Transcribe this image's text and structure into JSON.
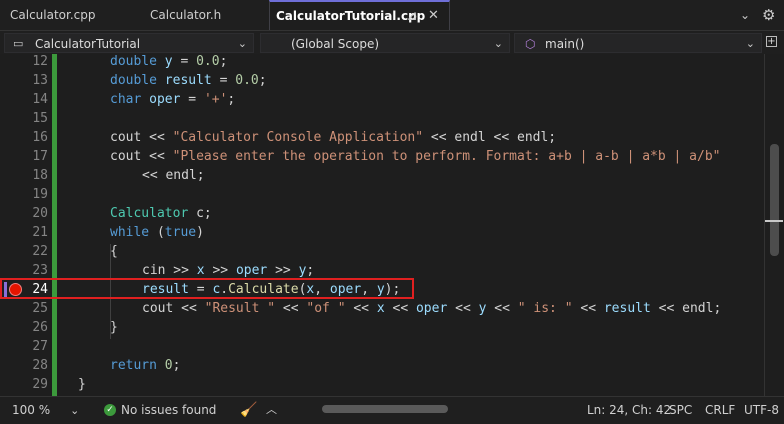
{
  "tabs": [
    {
      "label": "Calculator.cpp"
    },
    {
      "label": "Calculator.h"
    },
    {
      "label": "CalculatorTutorial.cpp"
    }
  ],
  "tab_icons": {
    "pin": "pin-icon",
    "close": "close-icon",
    "overflow": "chevron-down-icon",
    "settings": "gear-icon"
  },
  "nav": {
    "project": "CalculatorTutorial",
    "scope": "(Global Scope)",
    "member": "main()"
  },
  "editor": {
    "current_line": 24,
    "breakpoint_line": 24,
    "lines": [
      {
        "n": "12"
      },
      {
        "n": "13"
      },
      {
        "n": "14"
      },
      {
        "n": "15"
      },
      {
        "n": "16"
      },
      {
        "n": "17"
      },
      {
        "n": "18"
      },
      {
        "n": "19"
      },
      {
        "n": "20"
      },
      {
        "n": "21"
      },
      {
        "n": "22"
      },
      {
        "n": "23"
      },
      {
        "n": "24"
      },
      {
        "n": "25"
      },
      {
        "n": "26"
      },
      {
        "n": "27"
      },
      {
        "n": "28"
      },
      {
        "n": "29"
      }
    ],
    "code": {
      "l12_kw": "double",
      "l12_var": "y",
      "l12_op": " = ",
      "l12_num": "0.0",
      "l12_end": ";",
      "l13_kw": "double",
      "l13_var": "result",
      "l13_op": " = ",
      "l13_num": "0.0",
      "l13_end": ";",
      "l14_kw": "char",
      "l14_var": "oper",
      "l14_op": " = ",
      "l14_str": "'+'",
      "l14_end": ";",
      "l16_a": "cout << ",
      "l16_str": "\"Calculator Console Application\"",
      "l16_b": " << endl << endl;",
      "l17_a": "cout << ",
      "l17_str": "\"Please enter the operation to perform. Format: a+b | a-b | a*b | a/b\"",
      "l18_a": "<< endl;",
      "l20_ty": "Calculator",
      "l20_var": " c;",
      "l21_kw": "while",
      "l21_a": " (",
      "l21_kw2": "true",
      "l21_b": ")",
      "l22_a": "{",
      "l23_a": "cin >> ",
      "l23_v1": "x",
      "l23_b": " >> ",
      "l23_v2": "oper",
      "l23_c": " >> ",
      "l23_v3": "y",
      "l23_d": ";",
      "l24_v1": "result",
      "l24_a": " = ",
      "l24_v2": "c",
      "l24_b": ".",
      "l24_fn": "Calculate",
      "l24_c": "(",
      "l24_v3": "x",
      "l24_d": ", ",
      "l24_v4": "oper",
      "l24_e": ", ",
      "l24_v5": "y",
      "l24_f": ");",
      "l25_a": "cout << ",
      "l25_s1": "\"Result \"",
      "l25_b": " << ",
      "l25_s2": "\"of \"",
      "l25_c": " << ",
      "l25_v1": "x",
      "l25_d": " << ",
      "l25_v2": "oper",
      "l25_e": " << ",
      "l25_v3": "y",
      "l25_f": " << ",
      "l25_s3": "\" is: \"",
      "l25_g": " << ",
      "l25_v4": "result",
      "l25_h": " << endl;",
      "l26_a": "}",
      "l28_kw": "return",
      "l28_num": " 0",
      "l28_end": ";",
      "l29_a": "}"
    }
  },
  "status": {
    "zoom": "100 %",
    "issues": "No issues found",
    "position": "Ln: 24, Ch: 42",
    "whitespace": "SPC",
    "line_ending": "CRLF",
    "encoding": "UTF-8"
  },
  "colors": {
    "breakpoint": "#e51400",
    "highlight_box": "#e02020",
    "changes_bar": "#3c9a3c",
    "active_tab_accent": "#6f6fd8"
  }
}
